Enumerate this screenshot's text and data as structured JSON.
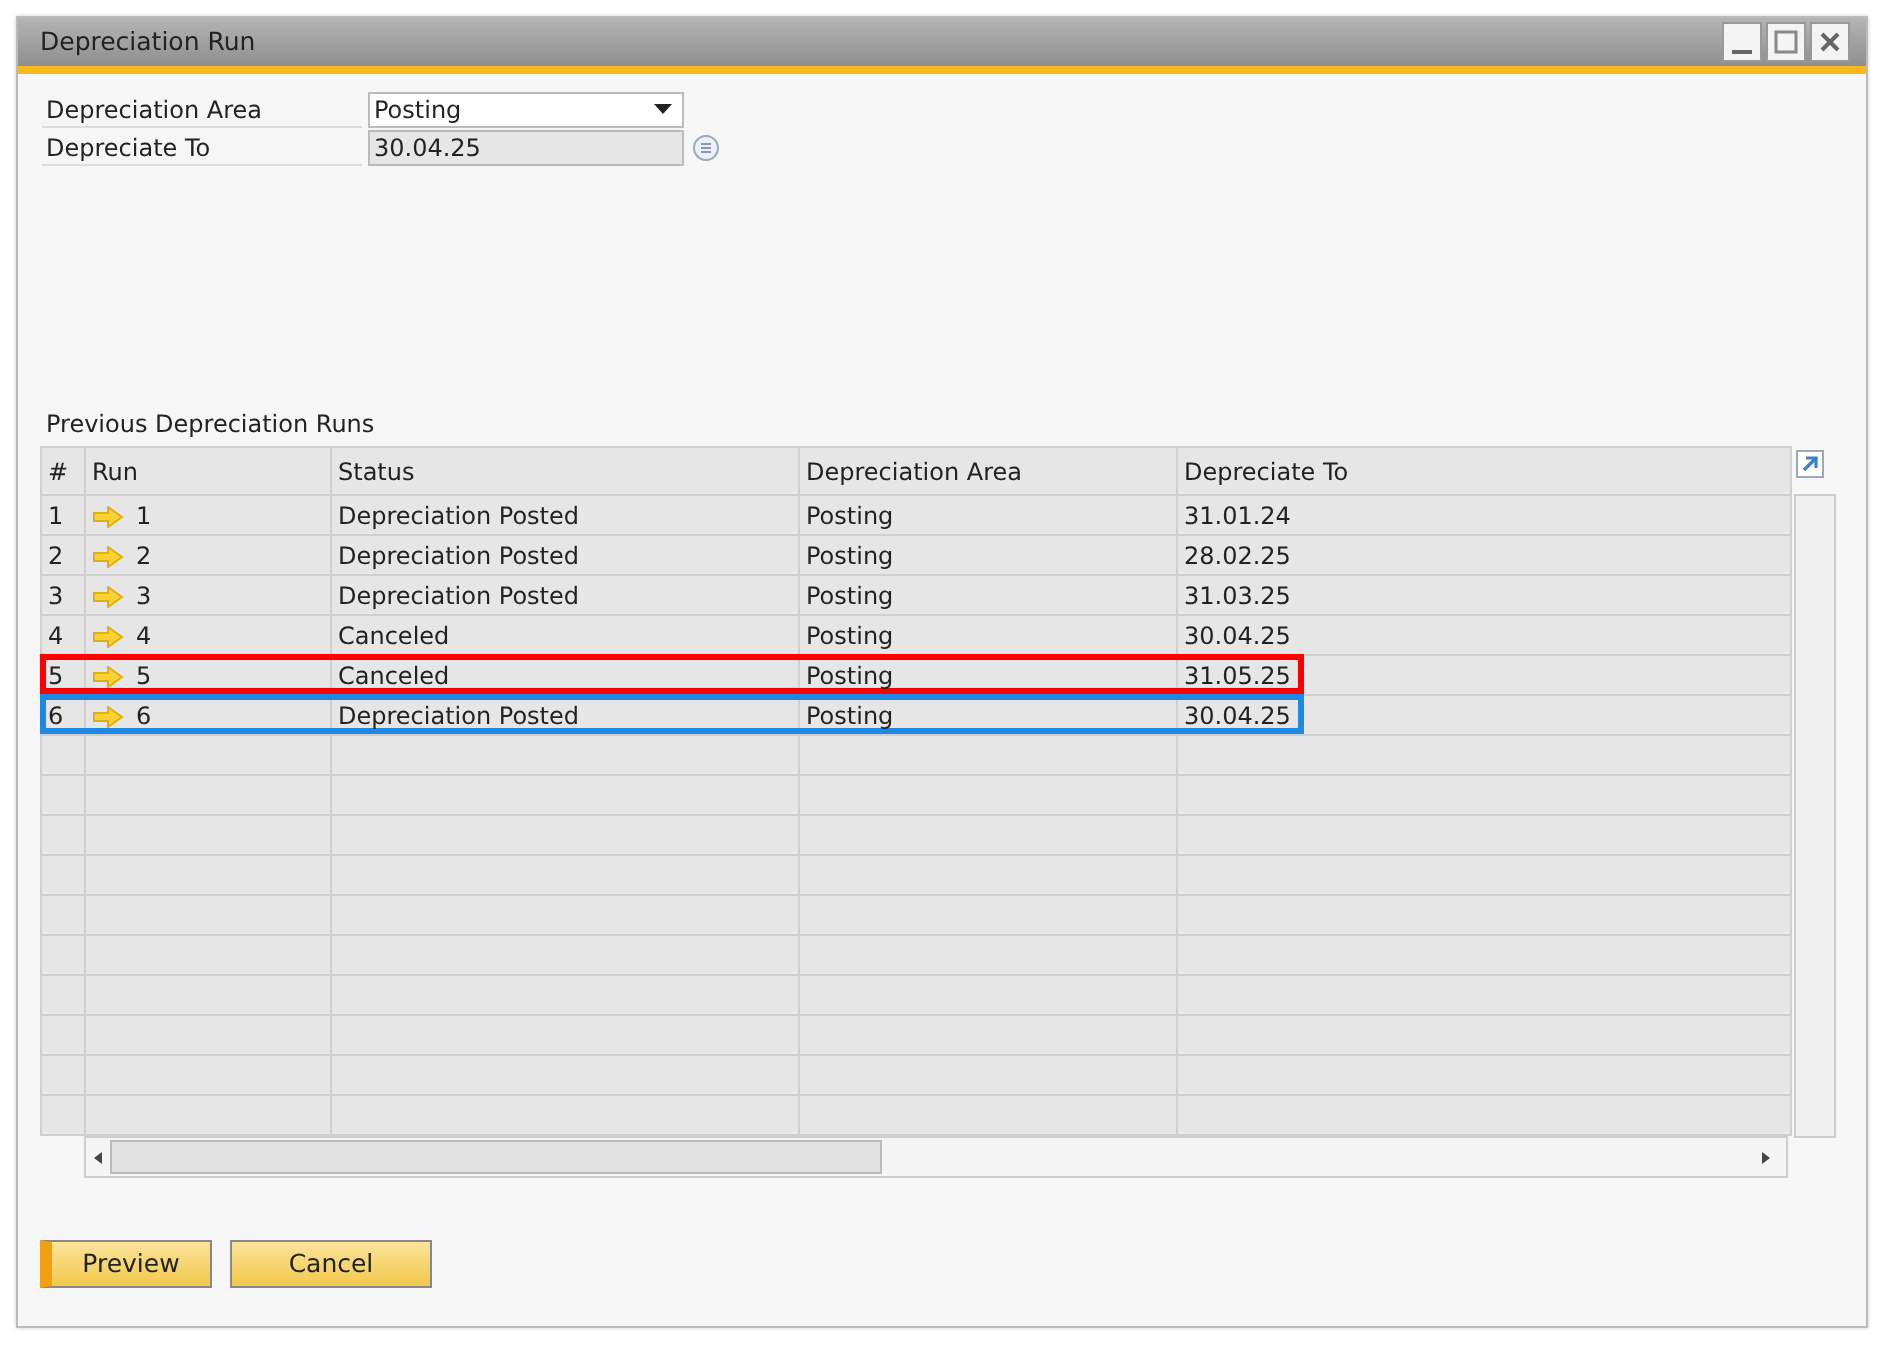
{
  "window": {
    "title": "Depreciation Run"
  },
  "fields": [
    {
      "label": "Depreciation Area",
      "value": "Posting",
      "kind": "dropdown"
    },
    {
      "label": "Depreciate To",
      "value": "30.04.25",
      "kind": "date"
    }
  ],
  "grid": {
    "caption": "Previous Depreciation Runs",
    "columns": [
      "#",
      "Run",
      "Status",
      "Depreciation Area",
      "Depreciate To"
    ],
    "rows": [
      {
        "cells": [
          "1",
          "1",
          "Depreciation Posted",
          "Posting",
          "31.01.24"
        ]
      },
      {
        "cells": [
          "2",
          "2",
          "Depreciation Posted",
          "Posting",
          "28.02.25"
        ]
      },
      {
        "cells": [
          "3",
          "3",
          "Depreciation Posted",
          "Posting",
          "31.03.25"
        ]
      },
      {
        "cells": [
          "4",
          "4",
          "Canceled",
          "Posting",
          "30.04.25"
        ]
      },
      {
        "cells": [
          "5",
          "5",
          "Canceled",
          "Posting",
          "31.05.25"
        ],
        "color": "#ff0000"
      },
      {
        "cells": [
          "6",
          "6",
          "Depreciation Posted",
          "Posting",
          "30.04.25"
        ],
        "color": "#1e88e5"
      }
    ]
  },
  "buttons": [
    {
      "label": "Preview",
      "selected": true
    },
    {
      "label": "Cancel",
      "selected": false
    }
  ]
}
